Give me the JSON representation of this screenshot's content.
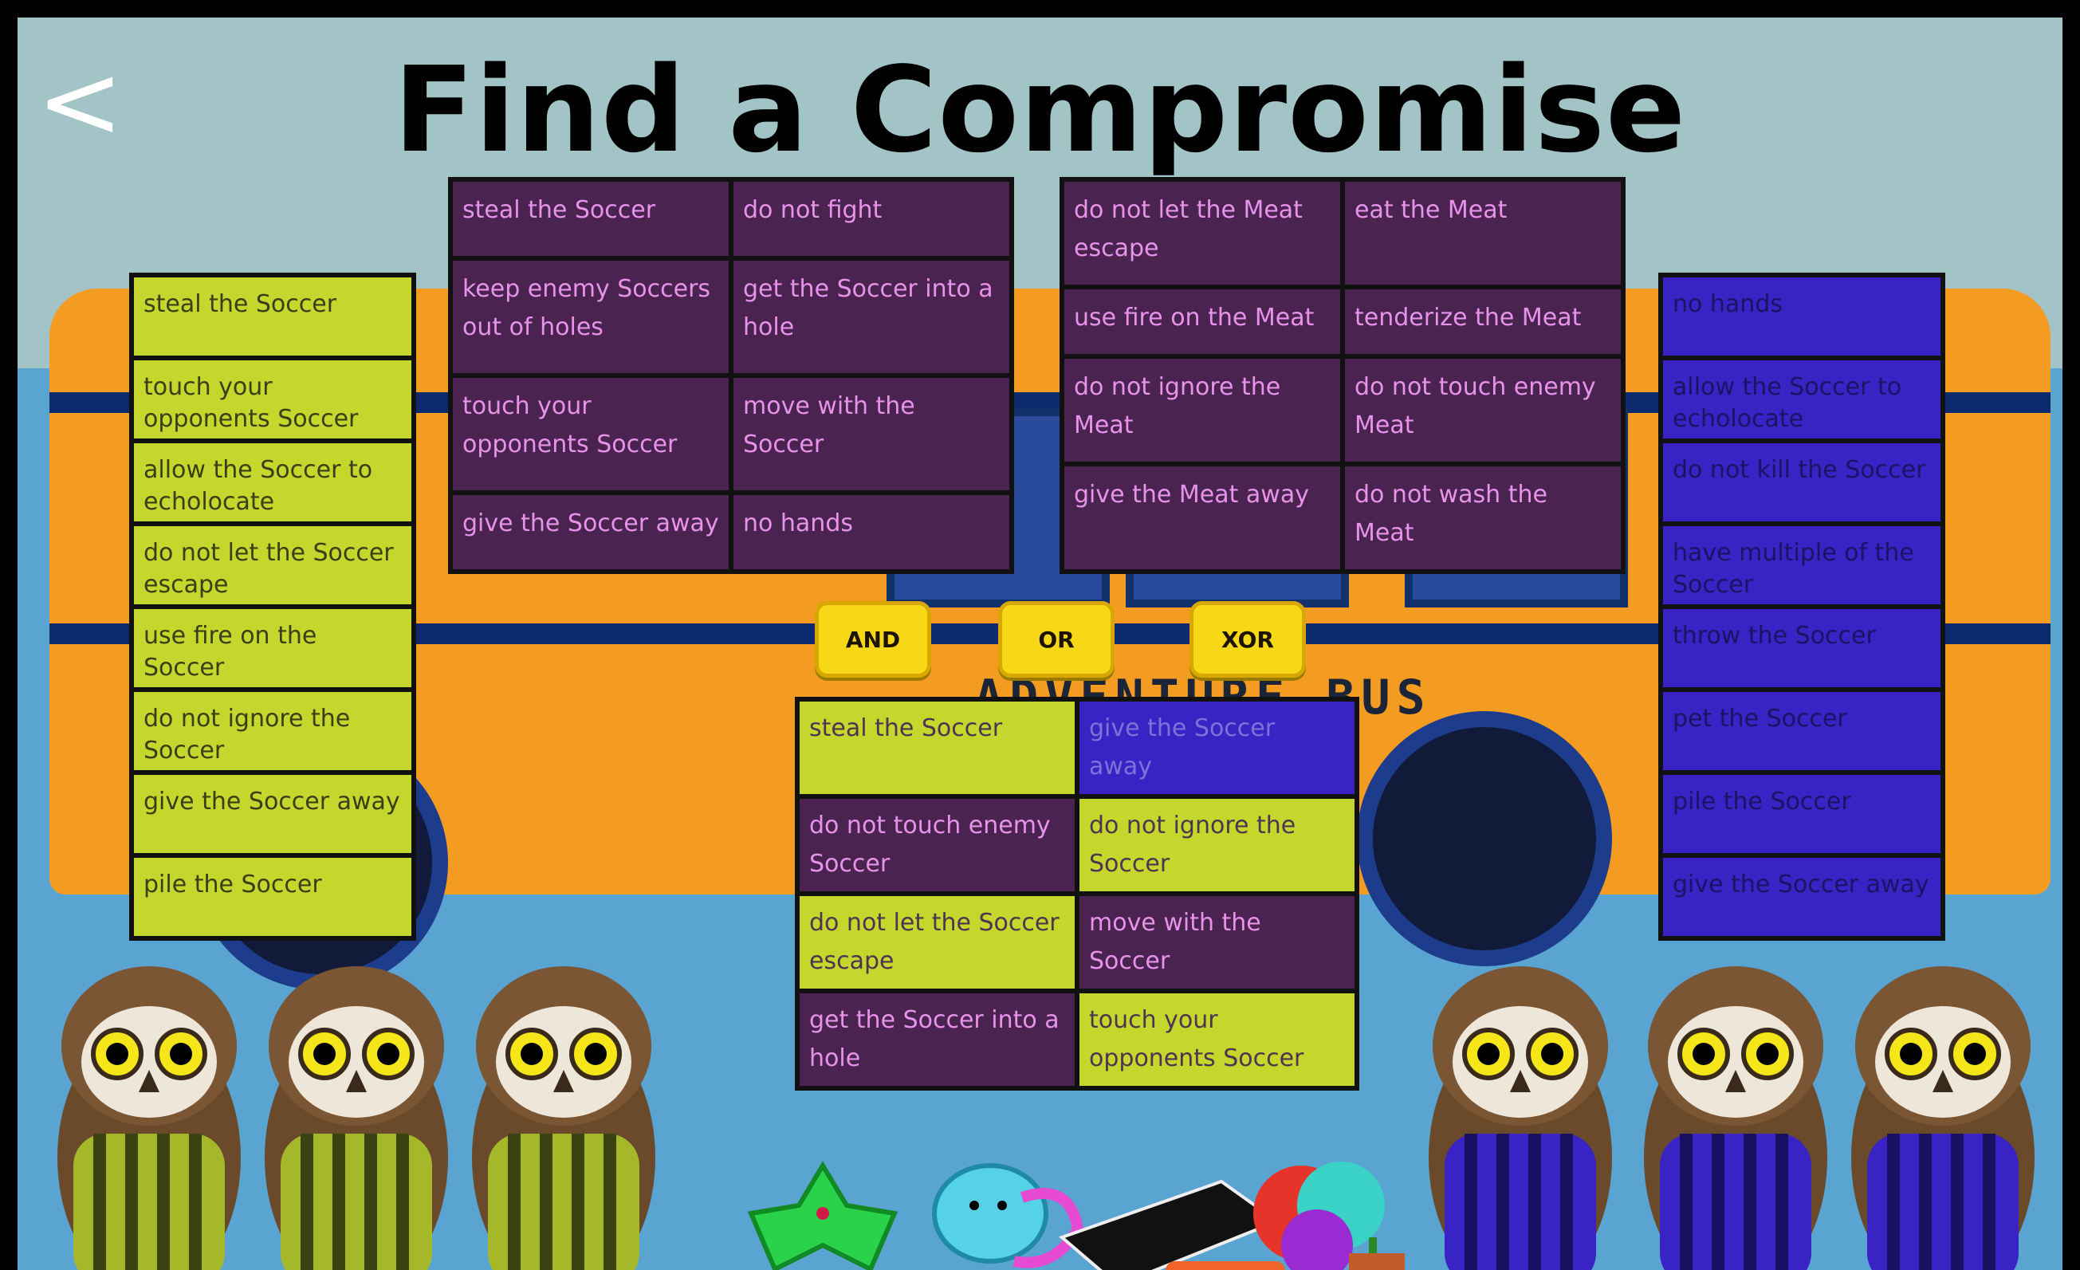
{
  "title": "Find a Compromise",
  "back_label": "<",
  "left_column": [
    "steal the Soccer",
    "touch your opponents Soccer",
    "allow the Soccer to echolocate",
    "do not let the Soccer escape",
    "use fire on the Soccer",
    "do not ignore the Soccer",
    "give the Soccer away",
    "pile the Soccer"
  ],
  "right_column": [
    "no hands",
    "allow the Soccer to echolocate",
    "do not kill the Soccer",
    "have multiple of the Soccer",
    "throw the Soccer",
    "pet the Soccer",
    "pile the Soccer",
    "give the Soccer away"
  ],
  "grid_left": [
    "steal the Soccer",
    "do not fight",
    "keep enemy Soccers out of holes",
    "get the Soccer into a hole",
    "touch your opponents Soccer",
    "move with the Soccer",
    "give the Soccer away",
    "no hands"
  ],
  "grid_right": [
    "do not let the Meat escape",
    "eat the Meat",
    "use fire on the Meat",
    "tenderize the Meat",
    "do not ignore the Meat",
    "do not touch enemy Meat",
    "give the Meat away",
    "do not wash the Meat"
  ],
  "operators": {
    "and": "AND",
    "or": "OR",
    "xor": "XOR"
  },
  "result": [
    {
      "text": "steal the Soccer",
      "team": "green"
    },
    {
      "text": "give the Soccer away",
      "team": "blue"
    },
    {
      "text": "do not touch enemy Soccer",
      "team": "purple"
    },
    {
      "text": "do not ignore the Soccer",
      "team": "green"
    },
    {
      "text": "do not let the Soccer escape",
      "team": "green"
    },
    {
      "text": "move with the Soccer",
      "team": "purple"
    },
    {
      "text": "get the Soccer into a hole",
      "team": "purple"
    },
    {
      "text": "touch your opponents Soccer",
      "team": "green"
    }
  ],
  "bus_text": "ADVENTURE BUS",
  "colors": {
    "green": "#c5d72c",
    "blue": "#3a23c5",
    "purple": "#4a2350",
    "operator": "#f7d816"
  }
}
